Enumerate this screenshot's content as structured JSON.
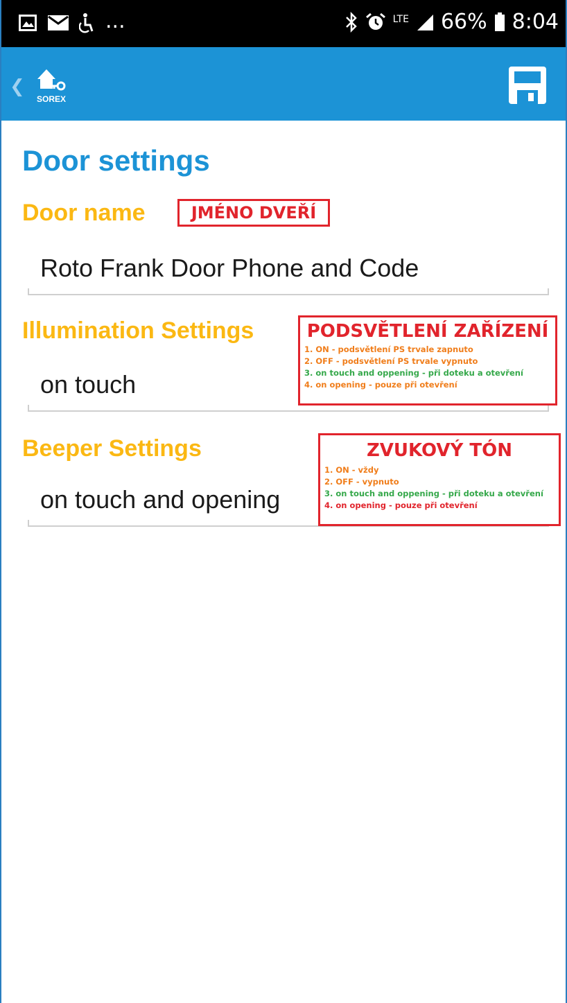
{
  "status_bar": {
    "battery_percent": "66%",
    "time": "8:04",
    "network": "LTE",
    "overflow": "...",
    "left_icons": [
      "image-notification-icon",
      "mail-notification-icon",
      "accessibility-icon"
    ],
    "right_icons": [
      "bluetooth-icon",
      "alarm-icon",
      "lte-icon",
      "signal-icon",
      "battery-icon"
    ]
  },
  "toolbar": {
    "logo_text": "SOREX",
    "back_icon": "chevron-left-icon",
    "save_icon": "floppy-disk-icon"
  },
  "page": {
    "title": "Door settings"
  },
  "sections": {
    "door_name": {
      "label": "Door name",
      "value": "Roto Frank Door Phone and Code",
      "annotation": "JMÉNO DVEŘÍ"
    },
    "illumination": {
      "label": "Illumination Settings",
      "value": "on touch",
      "annotation": {
        "title": "PODSVĚTLENÍ ZAŘÍZENÍ",
        "lines": [
          "1. ON - podsvětlení PS trvale zapnuto",
          "2. OFF - podsvětlení PS trvale vypnuto",
          "3. on touch and oppening - při doteku a otevření",
          "4. on opening - pouze při otevření"
        ]
      }
    },
    "beeper": {
      "label": "Beeper Settings",
      "value": "on touch and opening",
      "annotation": {
        "title": "ZVUKOVÝ TÓN",
        "lines": [
          "1. ON - vždy",
          "2. OFF - vypnuto",
          "3. on touch and oppening - při doteku a otevření",
          "4. on opening - pouze při otevření"
        ]
      }
    }
  },
  "colors": {
    "toolbar": "#1c93d6",
    "title": "#1c93d6",
    "label": "#fbb813",
    "annotation_red": "#e1242c",
    "annotation_orange": "#f07d1a",
    "annotation_green": "#35a84a"
  }
}
